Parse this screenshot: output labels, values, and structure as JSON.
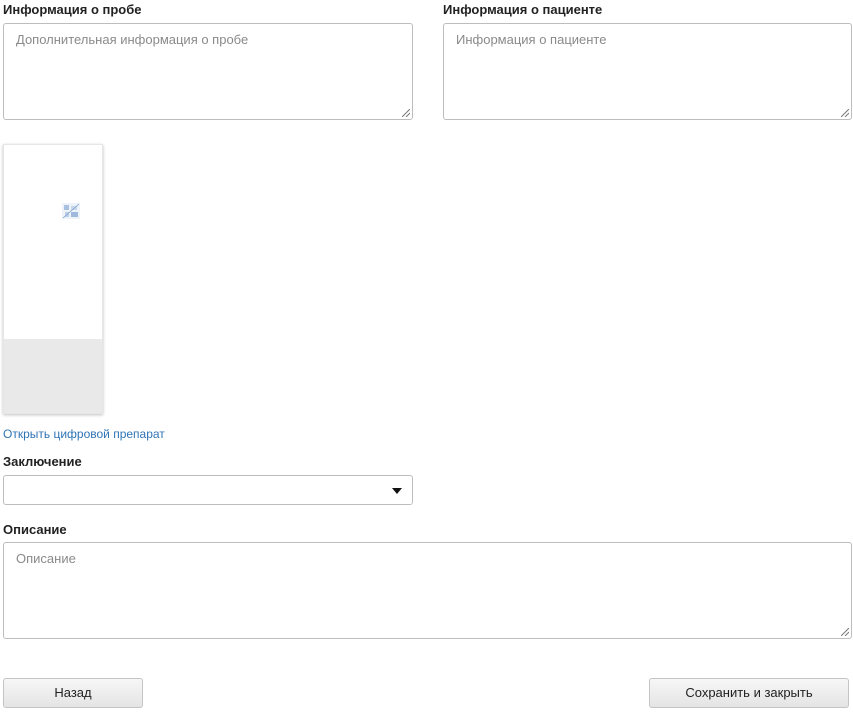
{
  "sample_info": {
    "label": "Информация о пробе",
    "placeholder": "Дополнительная информация о пробе",
    "value": ""
  },
  "patient_info": {
    "label": "Информация о пациенте",
    "placeholder": "Информация о пациенте",
    "value": ""
  },
  "slide": {
    "open_link": "Открыть цифровой препарат"
  },
  "conclusion": {
    "label": "Заключение",
    "selected": ""
  },
  "description": {
    "label": "Описание",
    "placeholder": "Описание",
    "value": ""
  },
  "footer": {
    "back_label": "Назад",
    "save_close_label": "Сохранить и закрыть"
  },
  "colors": {
    "link": "#2f74b5",
    "border": "#bdbdbd",
    "placeholder": "#8a8a8a"
  }
}
